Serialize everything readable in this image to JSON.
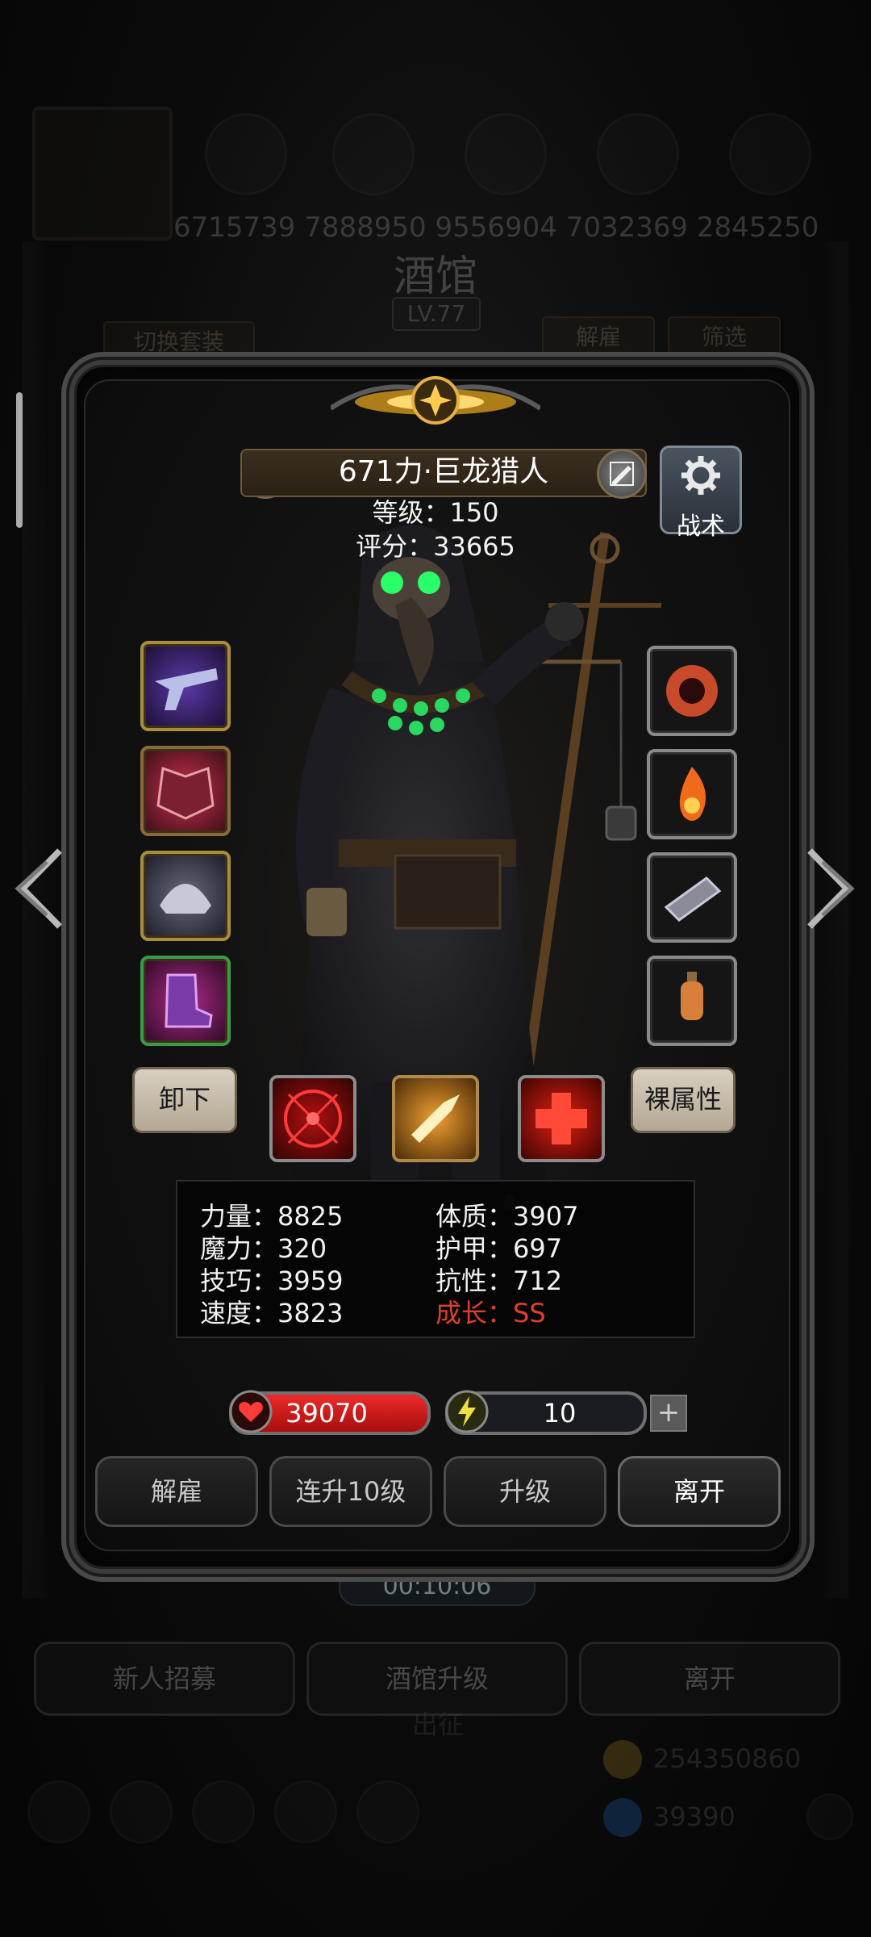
{
  "background": {
    "top_numbers": "6715739  7888950  9556904  7032369  2845250",
    "tavern_title": "酒馆",
    "tavern_level": "LV.77",
    "switch_outfit": "切换套装",
    "dismiss_tab": "解雇",
    "filter_tab": "筛选",
    "timer": "00:10:06",
    "buttons": [
      "新人招募",
      "酒馆升级",
      "离开"
    ],
    "expedition": "出征",
    "gold": "254350860",
    "gems": "39390"
  },
  "hero": {
    "name": "671力·巨龙猎人",
    "level": "等级：150",
    "score": "评分：33665",
    "tactics": "战术"
  },
  "equipment_left": [
    {
      "icon": "pistol-icon",
      "color": "#6a35c8"
    },
    {
      "icon": "chest-armor-icon",
      "color": "#c8304a"
    },
    {
      "icon": "helmet-icon",
      "color": "#8a8aa8"
    },
    {
      "icon": "boots-icon",
      "color": "#b02a8a"
    }
  ],
  "equipment_right": [
    {
      "icon": "flame-demon-icon",
      "color": "#c84a2a"
    },
    {
      "icon": "fire-spiral-icon",
      "color": "#f06a1a"
    },
    {
      "icon": "bracer-icon",
      "color": "#8a8a8a"
    },
    {
      "icon": "lantern-icon",
      "color": "#d8803a"
    }
  ],
  "actions": {
    "unequip": "卸下",
    "naked_stats": "裸属性"
  },
  "skills": [
    {
      "icon": "target-skill-icon"
    },
    {
      "icon": "strike-skill-icon"
    },
    {
      "icon": "heal-cross-skill-icon"
    }
  ],
  "stats": {
    "strength": "力量：8825",
    "magic": "魔力：320",
    "skill": "技巧：3959",
    "speed": "速度：3823",
    "constitution": "体质：3907",
    "armor": "护甲：697",
    "resistance": "抗性：712",
    "growth": "成长：SS"
  },
  "bars": {
    "hp": "39070",
    "hp_fraction": 1.0,
    "energy": "10",
    "energy_fraction": 0.1,
    "plus": "+"
  },
  "bottom_buttons": {
    "dismiss": "解雇",
    "level_up_10": "连升10级",
    "level_up": "升级",
    "leave": "离开"
  },
  "colors": {
    "growth_red": "#e0402a",
    "hp_red": "#d21a1a",
    "energy_yellow": "#e8d830"
  }
}
